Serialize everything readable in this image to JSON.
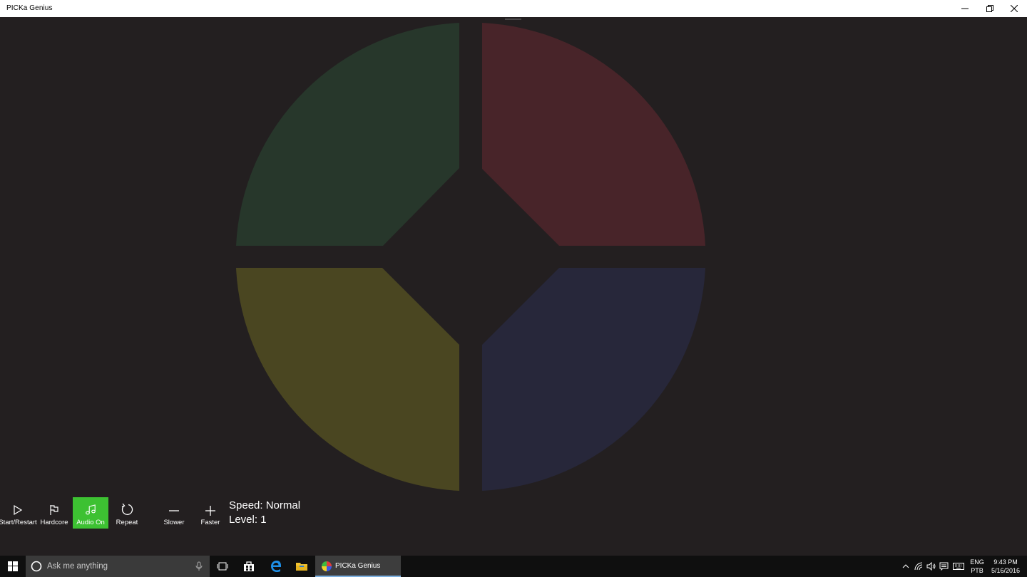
{
  "window": {
    "title": "PICKa Genius"
  },
  "colors": {
    "background": "#231f20",
    "pad_green": "#27372b",
    "pad_red": "#482429",
    "pad_yellow": "#4a4621",
    "pad_blue": "#27273a",
    "accent_active": "#3dc132"
  },
  "pads": [
    {
      "name": "green",
      "icon": null
    },
    {
      "name": "red",
      "icon": null
    },
    {
      "name": "yellow",
      "icon": null
    },
    {
      "name": "blue",
      "icon": null
    }
  ],
  "commands": {
    "start": {
      "label": "Start/Restart",
      "icon": "play-icon"
    },
    "hardcore": {
      "label": "Hardcore",
      "icon": "flag-icon"
    },
    "audio": {
      "label": "Audio On",
      "icon": "music-note-icon",
      "active": true
    },
    "repeat": {
      "label": "Repeat",
      "icon": "refresh-icon"
    },
    "slower": {
      "label": "Slower",
      "icon": "minus-icon"
    },
    "faster": {
      "label": "Faster",
      "icon": "plus-icon"
    }
  },
  "status": {
    "speed": "Speed: Normal",
    "level": "Level: 1"
  },
  "taskbar": {
    "search_placeholder": "Ask me anything",
    "active_app": "PICKa Genius",
    "language_top": "ENG",
    "language_bottom": "PTB",
    "time": "9:43 PM",
    "date": "5/16/2016"
  }
}
